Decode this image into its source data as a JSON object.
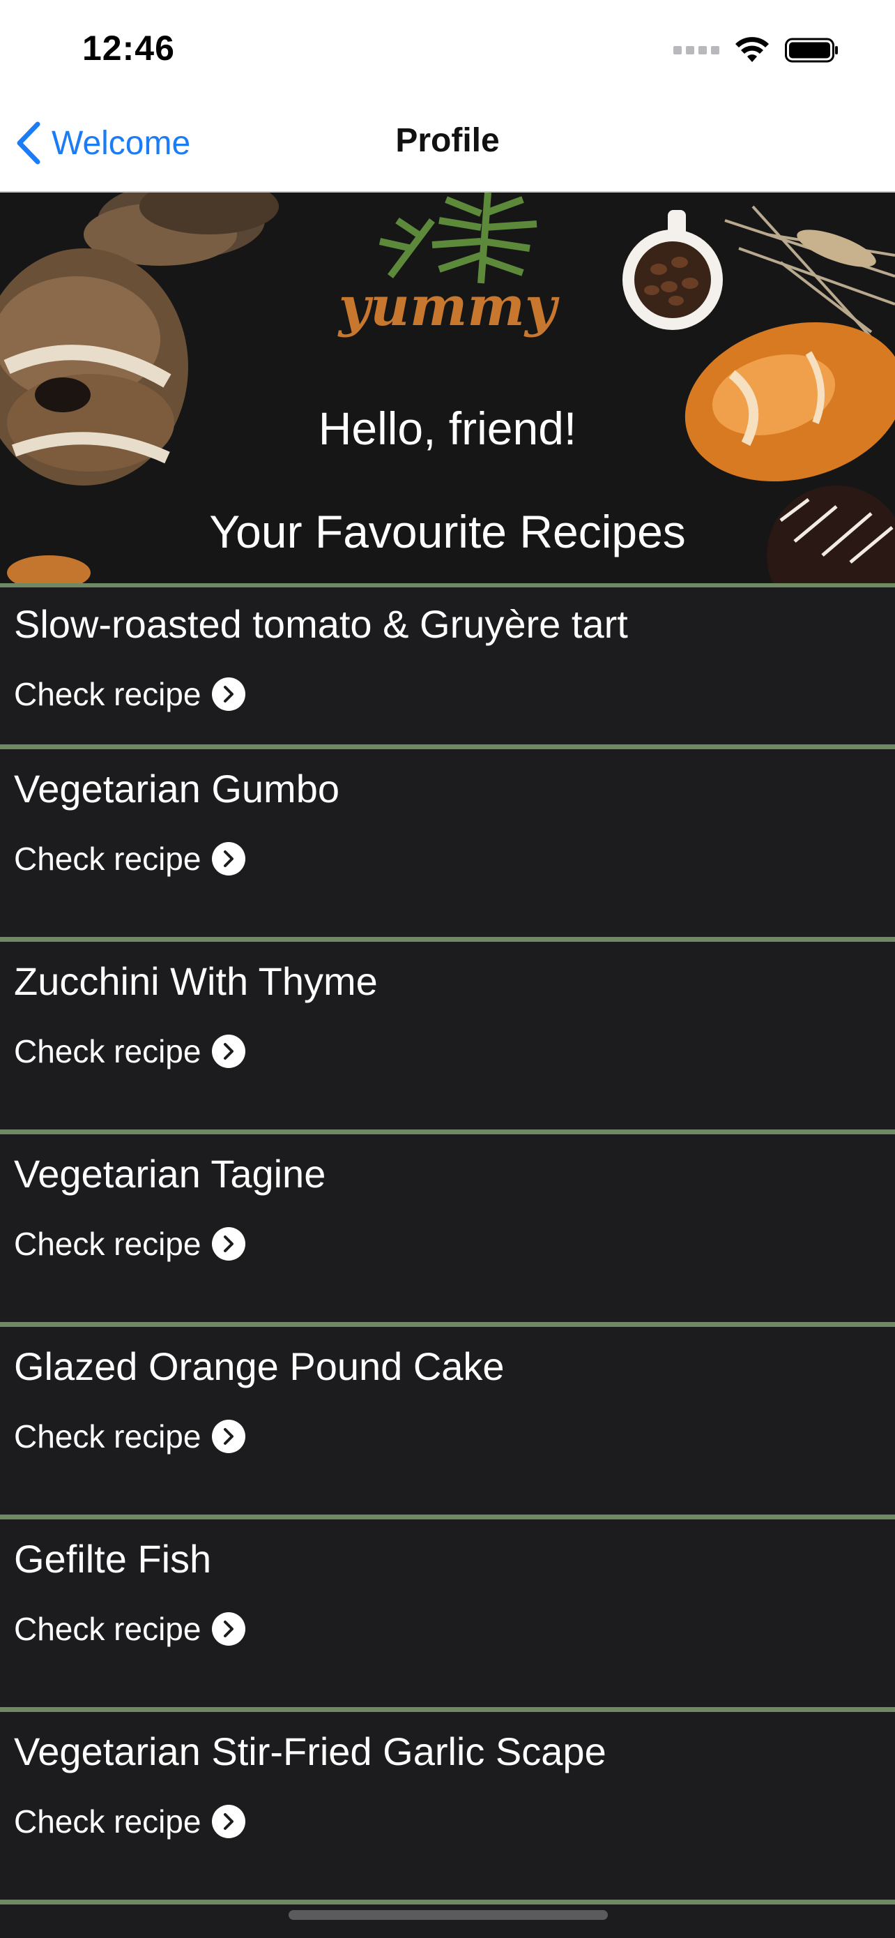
{
  "status_bar": {
    "time": "12:46"
  },
  "nav": {
    "back_label": "Welcome",
    "title": "Profile"
  },
  "hero": {
    "brand": "yummy",
    "greeting": "Hello, friend!",
    "heading": "Your Favourite Recipes"
  },
  "recipes": [
    {
      "name": "Slow-roasted tomato & Gruyère tart",
      "link": "Check recipe"
    },
    {
      "name": "Vegetarian Gumbo",
      "link": "Check recipe"
    },
    {
      "name": "Zucchini With Thyme",
      "link": "Check recipe"
    },
    {
      "name": "Vegetarian Tagine",
      "link": "Check recipe"
    },
    {
      "name": "Glazed Orange Pound Cake",
      "link": "Check recipe"
    },
    {
      "name": "Gefilte Fish",
      "link": "Check recipe"
    },
    {
      "name": "Vegetarian Stir-Fried Garlic Scape",
      "link": "Check recipe"
    }
  ],
  "colors": {
    "accent": "#1b7cf5",
    "divider": "#6f8a63",
    "background": "#1c1c1e",
    "brand": "#c8782e"
  },
  "icons": [
    "signal-icon",
    "wifi-icon",
    "battery-icon",
    "chevron-left-icon",
    "chevron-right-circle-icon"
  ]
}
